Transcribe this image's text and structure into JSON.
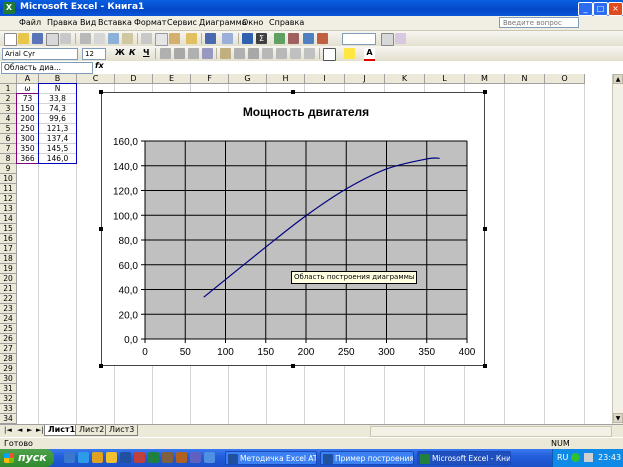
{
  "window": {
    "title": "Microsoft Excel - Книга1",
    "app_icon": "X",
    "btn_minimize": "_",
    "btn_maximize": "□",
    "btn_close": "×"
  },
  "menu": {
    "items": [
      "Файл",
      "Правка",
      "Вид",
      "Вставка",
      "Формат",
      "Сервис",
      "Диаграмма",
      "Окно",
      "Справка"
    ],
    "help_placeholder": "Введите вопрос"
  },
  "format_toolbar": {
    "font": "Arial Cyr",
    "size": "12",
    "bold": "Ж",
    "italic": "К",
    "underline": "Ч"
  },
  "formula_bar": {
    "name_box": "Область диа...",
    "fx": "fx",
    "value": ""
  },
  "columns": [
    "A",
    "B",
    "C",
    "D",
    "E",
    "F",
    "G",
    "H",
    "I",
    "J",
    "K",
    "L",
    "M",
    "N",
    "O"
  ],
  "rows": [
    "1",
    "2",
    "3",
    "4",
    "5",
    "6",
    "7",
    "8",
    "9",
    "10",
    "11",
    "12",
    "13",
    "14",
    "15",
    "16",
    "17",
    "18",
    "19",
    "20",
    "21",
    "22",
    "23",
    "24",
    "25",
    "26",
    "27",
    "28",
    "29",
    "30",
    "31",
    "32",
    "33",
    "34"
  ],
  "table": {
    "headers": [
      "ω",
      "N"
    ],
    "rows": [
      [
        "73",
        "33,8"
      ],
      [
        "150",
        "74,3"
      ],
      [
        "200",
        "99,6"
      ],
      [
        "250",
        "121,3"
      ],
      [
        "300",
        "137,4"
      ],
      [
        "350",
        "145,5"
      ],
      [
        "366",
        "146,0"
      ]
    ]
  },
  "chart_data": {
    "type": "line",
    "title": "Мощность двигателя",
    "x": [
      73,
      150,
      200,
      250,
      300,
      350,
      366
    ],
    "series": [
      {
        "values": [
          33.8,
          74.3,
          99.6,
          121.3,
          137.4,
          145.5,
          146.0
        ]
      }
    ],
    "xlim": [
      0,
      400
    ],
    "ylim": [
      0,
      160
    ],
    "x_ticks": [
      "0",
      "50",
      "100",
      "150",
      "200",
      "250",
      "300",
      "350",
      "400"
    ],
    "y_ticks": [
      "0,0",
      "20,0",
      "40,0",
      "60,0",
      "80,0",
      "100,0",
      "120,0",
      "140,0",
      "160,0"
    ],
    "grid": true,
    "plot_bg": "#c0c0c0",
    "line_color": "#000080",
    "smoothed": true
  },
  "tooltip": "Область построения диаграммы",
  "sheet_tabs": [
    "Лист1",
    "Лист2",
    "Лист3"
  ],
  "status": {
    "left": "Готово",
    "num": "NUM"
  },
  "taskbar": {
    "start": "пуск",
    "buttons": [
      "Методичка Excel AT ...",
      "Пример построения ...",
      "Microsoft Excel - Кни..."
    ],
    "lang": "RU",
    "time": "23:43"
  }
}
